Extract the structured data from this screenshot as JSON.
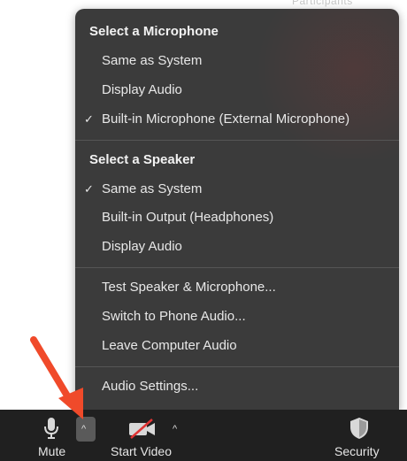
{
  "top_corner_text": "Participants",
  "menu": {
    "microphone_header": "Select a Microphone",
    "microphone_items": [
      {
        "label": "Same as System",
        "checked": false
      },
      {
        "label": "Display Audio",
        "checked": false
      },
      {
        "label": "Built-in Microphone (External Microphone)",
        "checked": true
      }
    ],
    "speaker_header": "Select a Speaker",
    "speaker_items": [
      {
        "label": "Same as System",
        "checked": true
      },
      {
        "label": "Built-in Output (Headphones)",
        "checked": false
      },
      {
        "label": "Display Audio",
        "checked": false
      }
    ],
    "actions": [
      "Test Speaker & Microphone...",
      "Switch to Phone Audio...",
      "Leave Computer Audio"
    ],
    "settings": "Audio Settings...",
    "check_glyph": "✓"
  },
  "toolbar": {
    "mute_label": "Mute",
    "start_video_label": "Start Video",
    "security_label": "Security",
    "caret_glyph": "^"
  },
  "colors": {
    "menu_bg": "#3b3b3b",
    "toolbar_bg": "#202020",
    "arrow": "#f04a2a",
    "video_slash": "#e03434"
  }
}
